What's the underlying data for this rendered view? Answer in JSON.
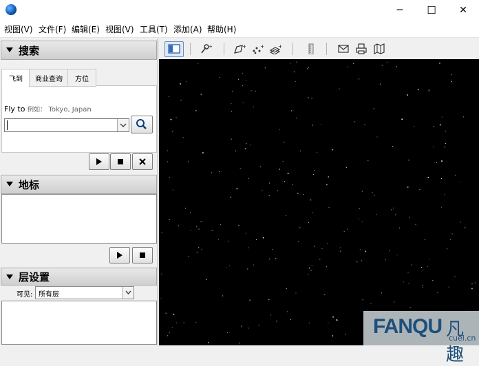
{
  "window": {
    "minimize_glyph": "─",
    "maximize_glyph": "☐",
    "close_glyph": "✕"
  },
  "menu": [
    "视图(V)",
    "文件(F)",
    "编辑(E)",
    "视图(V)",
    "工具(T)",
    "添加(A)",
    "帮助(H)"
  ],
  "search_panel": {
    "title": "搜索",
    "tabs": [
      "飞到",
      "商业查询",
      "方位"
    ],
    "fly_to_label": "Fly to",
    "example_prefix": "例如：",
    "example_value": "Tokyo, Japan",
    "input_value": ""
  },
  "places_panel": {
    "title": "地标"
  },
  "layers_panel": {
    "title": "层设置",
    "view_label": "可见:",
    "view_value": "所有层"
  },
  "watermark": {
    "brand": "FANQU",
    "cn": "凡趣",
    "domain": "cuel.cn"
  },
  "colors": {
    "viewport": "#000000",
    "panel_bg": "#f0f0f0",
    "globe": "#1c6fd1"
  }
}
